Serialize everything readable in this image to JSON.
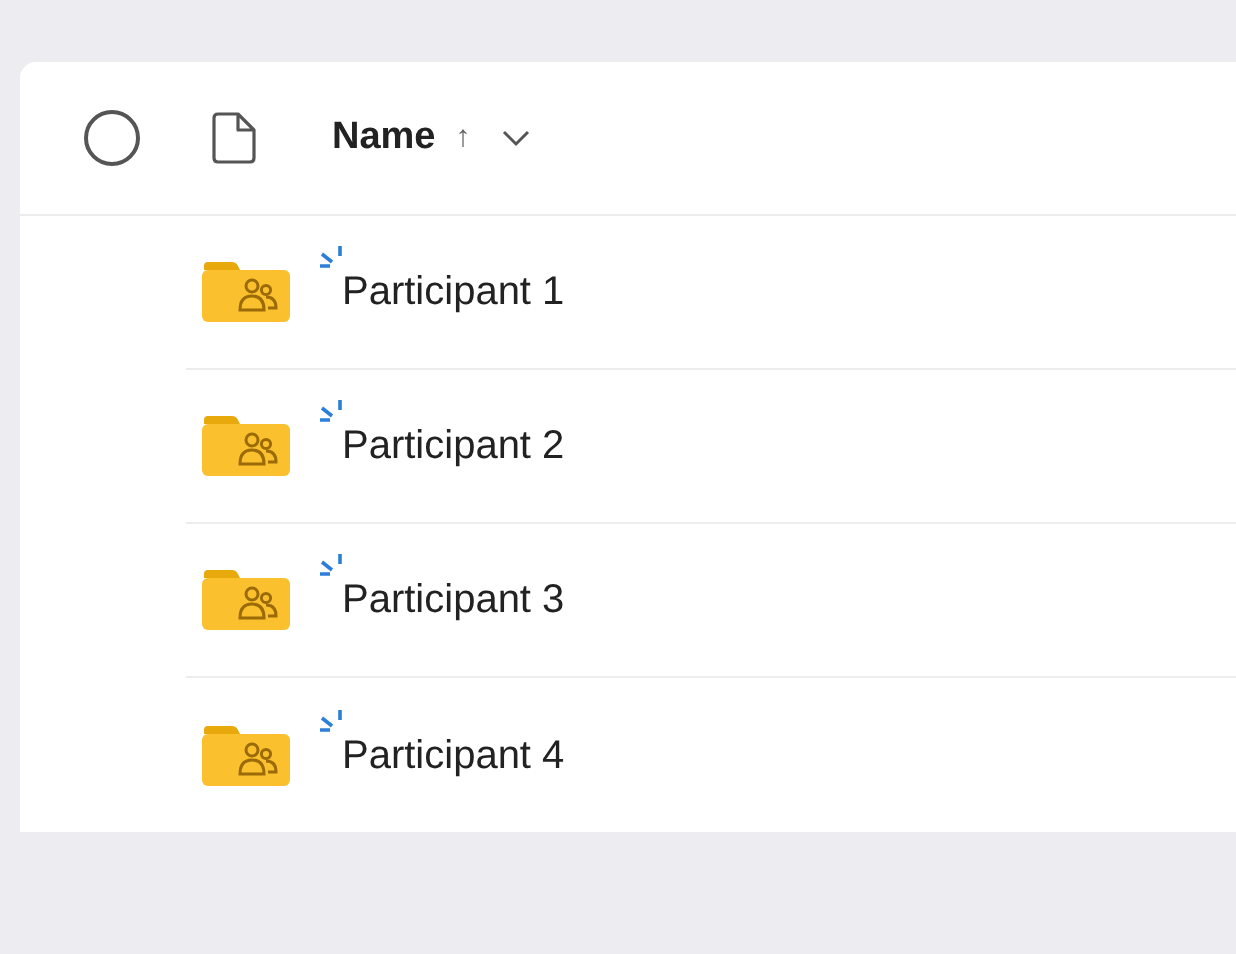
{
  "header": {
    "all_selected": false,
    "column": "Name",
    "sort_arrow": "↑"
  },
  "rows": [
    {
      "name": "Participant 1",
      "new": true
    },
    {
      "name": "Participant 2",
      "new": true
    },
    {
      "name": "Participant 3",
      "new": true
    },
    {
      "name": "Participant 4",
      "new": true
    }
  ]
}
